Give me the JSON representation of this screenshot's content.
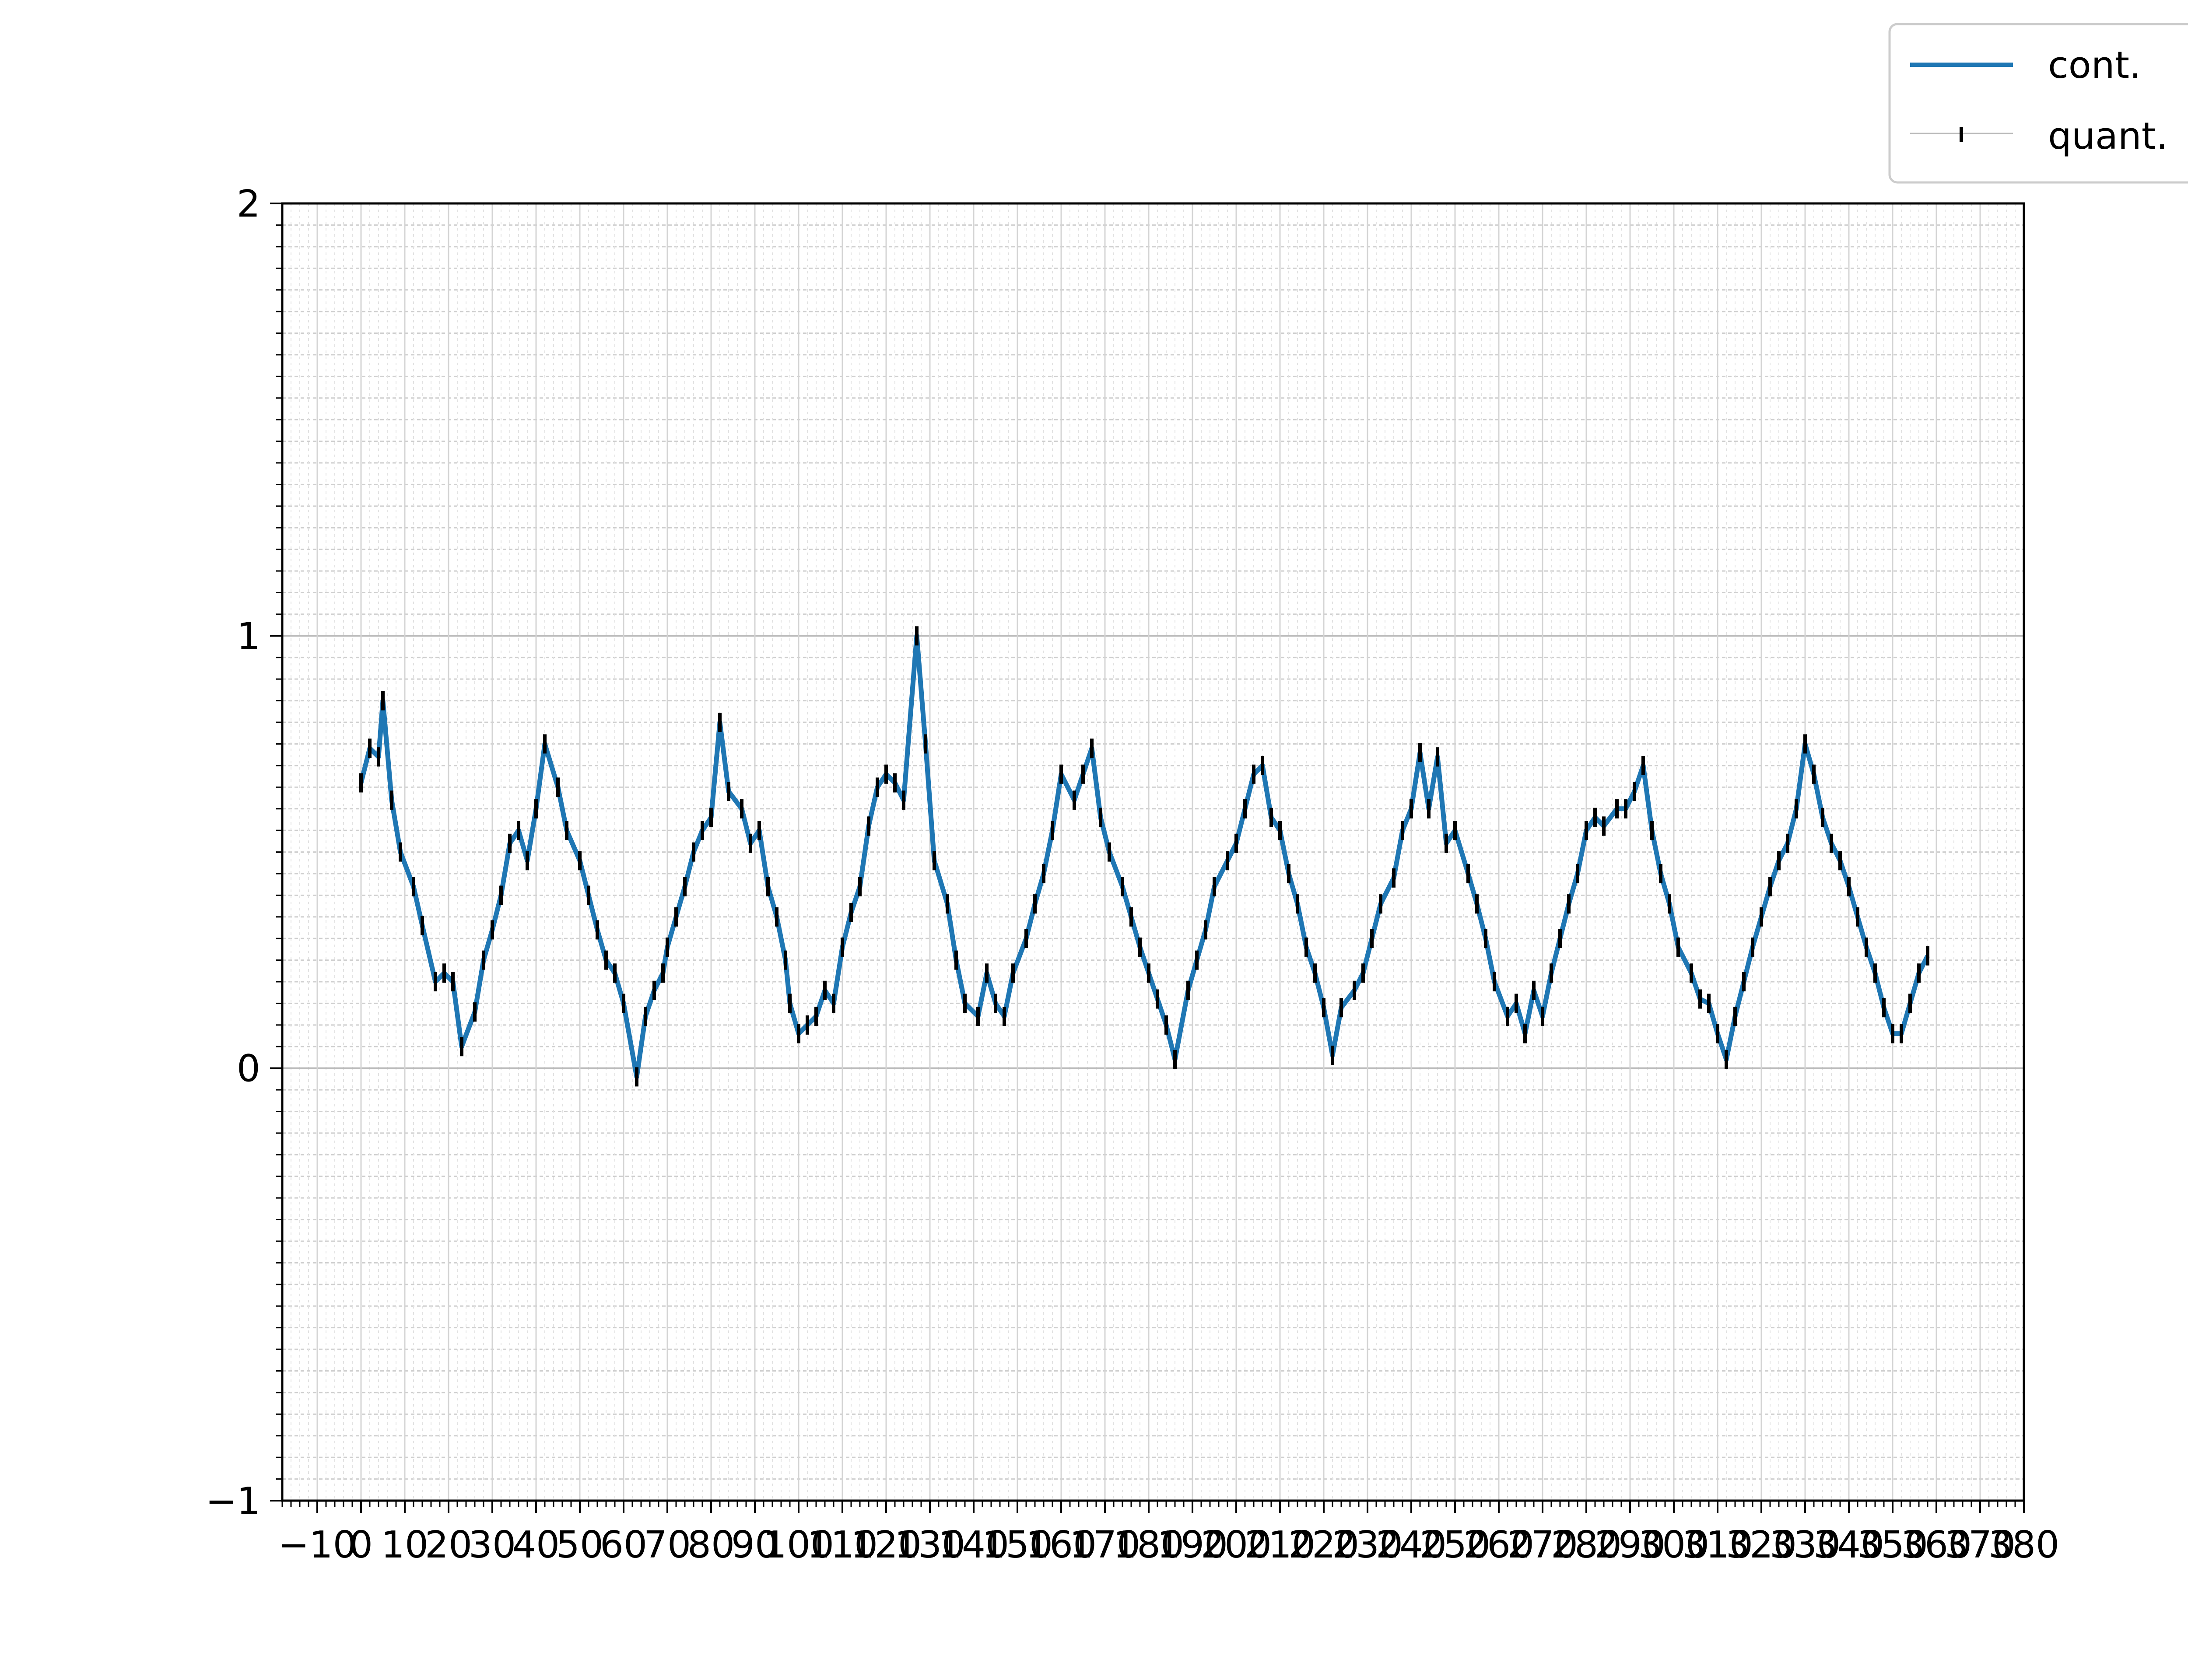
{
  "chart_data": {
    "type": "line",
    "title": "",
    "xlabel": "",
    "ylabel": "",
    "xlim": [
      -18,
      380
    ],
    "ylim": [
      -1,
      2
    ],
    "grid": true,
    "legend_position": "top-right",
    "x_ticks": [
      -10,
      0,
      10,
      20,
      30,
      40,
      50,
      60,
      70,
      80,
      90,
      100,
      110,
      120,
      130,
      140,
      150,
      160,
      170,
      180,
      190,
      200,
      210,
      220,
      230,
      240,
      250,
      260,
      270,
      280,
      290,
      300,
      310,
      320,
      330,
      340,
      350,
      360,
      370,
      380
    ],
    "x_tick_labels": [
      "−10",
      "0",
      "10",
      "20",
      "30",
      "40",
      "50",
      "60",
      "70",
      "80",
      "90",
      "100",
      "110",
      "120",
      "130",
      "140",
      "150",
      "160",
      "170",
      "180",
      "190",
      "200",
      "210",
      "220",
      "230",
      "240",
      "250",
      "260",
      "270",
      "280",
      "290",
      "300",
      "310",
      "320",
      "330",
      "340",
      "350",
      "360",
      "370",
      "380"
    ],
    "y_ticks": [
      -1,
      0,
      1,
      2
    ],
    "y_tick_labels": [
      "−1",
      "0",
      "1",
      "2"
    ],
    "series": [
      {
        "name": "cont.",
        "color": "#1f77b4",
        "style": "line",
        "x": [
          0,
          2,
          4,
          5,
          7,
          9,
          12,
          14,
          17,
          19,
          21,
          23,
          26,
          28,
          30,
          32,
          34,
          36,
          38,
          40,
          42,
          45,
          47,
          50,
          52,
          54,
          56,
          58,
          60,
          63,
          65,
          67,
          69,
          70,
          72,
          74,
          76,
          78,
          80,
          82,
          84,
          87,
          89,
          91,
          93,
          95,
          97,
          98,
          100,
          102,
          104,
          106,
          108,
          110,
          112,
          114,
          116,
          118,
          120,
          122,
          124,
          127,
          129,
          131,
          134,
          136,
          138,
          141,
          143,
          145,
          147,
          149,
          152,
          154,
          156,
          158,
          160,
          163,
          165,
          167,
          169,
          171,
          174,
          176,
          178,
          180,
          182,
          184,
          186,
          189,
          191,
          193,
          195,
          198,
          200,
          202,
          204,
          206,
          208,
          210,
          212,
          214,
          216,
          218,
          220,
          222,
          224,
          227,
          229,
          231,
          233,
          236,
          238,
          240,
          242,
          244,
          246,
          248,
          250,
          253,
          255,
          257,
          259,
          262,
          264,
          266,
          268,
          270,
          272,
          274,
          276,
          278,
          280,
          282,
          284,
          287,
          289,
          291,
          293,
          295,
          297,
          299,
          301,
          304,
          306,
          308,
          310,
          312,
          314,
          316,
          318,
          320,
          322,
          324,
          326,
          328,
          330,
          332,
          334,
          336,
          338,
          340,
          342,
          344,
          346,
          348,
          350,
          352,
          354,
          356,
          358
        ],
        "y": [
          0.66,
          0.74,
          0.72,
          0.85,
          0.62,
          0.5,
          0.42,
          0.33,
          0.2,
          0.22,
          0.2,
          0.05,
          0.13,
          0.25,
          0.32,
          0.4,
          0.52,
          0.55,
          0.48,
          0.6,
          0.75,
          0.65,
          0.55,
          0.48,
          0.4,
          0.32,
          0.25,
          0.22,
          0.15,
          -0.02,
          0.12,
          0.18,
          0.22,
          0.28,
          0.35,
          0.42,
          0.5,
          0.55,
          0.58,
          0.8,
          0.64,
          0.6,
          0.52,
          0.55,
          0.42,
          0.35,
          0.25,
          0.15,
          0.08,
          0.1,
          0.12,
          0.18,
          0.15,
          0.28,
          0.36,
          0.42,
          0.56,
          0.65,
          0.68,
          0.66,
          0.62,
          1.0,
          0.75,
          0.48,
          0.38,
          0.25,
          0.15,
          0.12,
          0.22,
          0.15,
          0.12,
          0.22,
          0.3,
          0.38,
          0.45,
          0.55,
          0.68,
          0.62,
          0.68,
          0.74,
          0.58,
          0.5,
          0.42,
          0.35,
          0.28,
          0.22,
          0.16,
          0.1,
          0.02,
          0.18,
          0.25,
          0.32,
          0.42,
          0.48,
          0.52,
          0.6,
          0.68,
          0.7,
          0.58,
          0.55,
          0.45,
          0.38,
          0.28,
          0.22,
          0.14,
          0.03,
          0.14,
          0.18,
          0.22,
          0.3,
          0.38,
          0.44,
          0.55,
          0.6,
          0.73,
          0.6,
          0.72,
          0.52,
          0.55,
          0.45,
          0.38,
          0.3,
          0.2,
          0.12,
          0.15,
          0.08,
          0.18,
          0.12,
          0.22,
          0.3,
          0.38,
          0.45,
          0.55,
          0.58,
          0.56,
          0.6,
          0.6,
          0.64,
          0.7,
          0.55,
          0.45,
          0.38,
          0.28,
          0.22,
          0.16,
          0.15,
          0.08,
          0.02,
          0.12,
          0.2,
          0.28,
          0.35,
          0.42,
          0.48,
          0.52,
          0.6,
          0.75,
          0.68,
          0.58,
          0.52,
          0.48,
          0.42,
          0.35,
          0.28,
          0.22,
          0.14,
          0.08,
          0.08,
          0.15,
          0.22,
          0.26
        ],
        "x_b": [],
        "y_b": []
      },
      {
        "name": "quant.",
        "color": "#000000",
        "style": "errorbar-markers",
        "x": [],
        "y": []
      }
    ]
  },
  "legend": {
    "items": [
      {
        "label": "cont.",
        "color": "#1f77b4",
        "marker": "line"
      },
      {
        "label": "quant.",
        "color": "#000000",
        "marker": "errorbar"
      }
    ]
  }
}
